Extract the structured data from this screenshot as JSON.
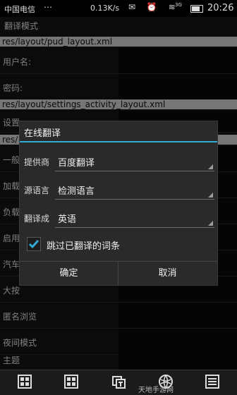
{
  "status": {
    "carrier": "中国电信",
    "dots": "⋯",
    "speed": "0.13K/s",
    "icons": "✉ ⏰ ≋",
    "net": "3G",
    "time": "20:26"
  },
  "header": {
    "title": "翻译模式"
  },
  "list": {
    "path1": "res/layout/pud_layout.xml",
    "username": "用户名:",
    "password": "密码:",
    "path2": "res/layout/settings_activity_layout.xml",
    "settings": "设置",
    "path3": "res/",
    "general": "一般",
    "load": "加载",
    "load2": "负载",
    "enable": "启用",
    "car": "汽车",
    "big": "大按",
    "anonymous": "匿名浏览",
    "night_mode": "夜间模式",
    "theme": "主题"
  },
  "dialog": {
    "title": "在线翻译",
    "provider_label": "提供商",
    "provider_value": "百度翻译",
    "source_label": "源语言",
    "source_value": "检测语言",
    "target_label": "翻译成",
    "target_value": "英语",
    "skip_label": "跳过已翻译的词条",
    "skip_checked": true,
    "ok": "确定",
    "cancel": "取消"
  },
  "bottom": {
    "icons": [
      "grid-icon",
      "grid-icon",
      "translate-icon",
      "globe-icon",
      "menu-icon"
    ]
  },
  "watermark": "天地手游网",
  "colors": {
    "accent": "#33a9d6",
    "path_bg": "#d7d7d7",
    "dialog_bg": "#2a2a2a"
  }
}
